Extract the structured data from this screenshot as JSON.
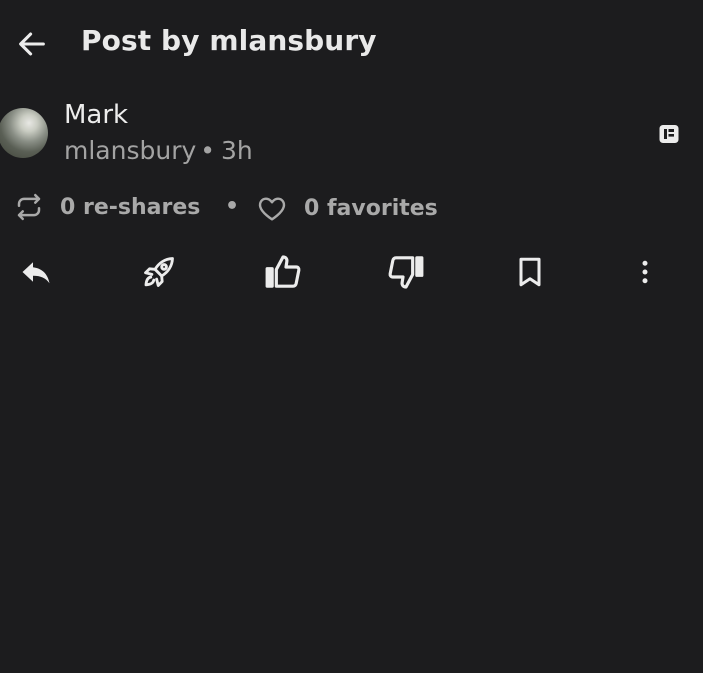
{
  "header": {
    "title": "Post by mlansbury",
    "back_icon": "arrow-left-icon"
  },
  "post": {
    "author_display_name": "Mark",
    "author_handle": "mlansbury",
    "separator": "•",
    "age": "3h",
    "flair_icon": "flair-icon"
  },
  "stats": {
    "reshares_label": "0 re-shares",
    "separator": "•",
    "favorites_label": "0 favorites"
  },
  "actions": [
    {
      "name": "reply",
      "icon": "reply-icon"
    },
    {
      "name": "boost",
      "icon": "rocket-icon"
    },
    {
      "name": "upvote",
      "icon": "thumbs-up-icon"
    },
    {
      "name": "downvote",
      "icon": "thumbs-down-icon"
    },
    {
      "name": "bookmark",
      "icon": "bookmark-icon"
    },
    {
      "name": "more",
      "icon": "more-vertical-icon"
    }
  ],
  "colors": {
    "background": "#1c1c1e",
    "text_primary": "#ececec",
    "text_secondary": "#a3a3a3"
  }
}
